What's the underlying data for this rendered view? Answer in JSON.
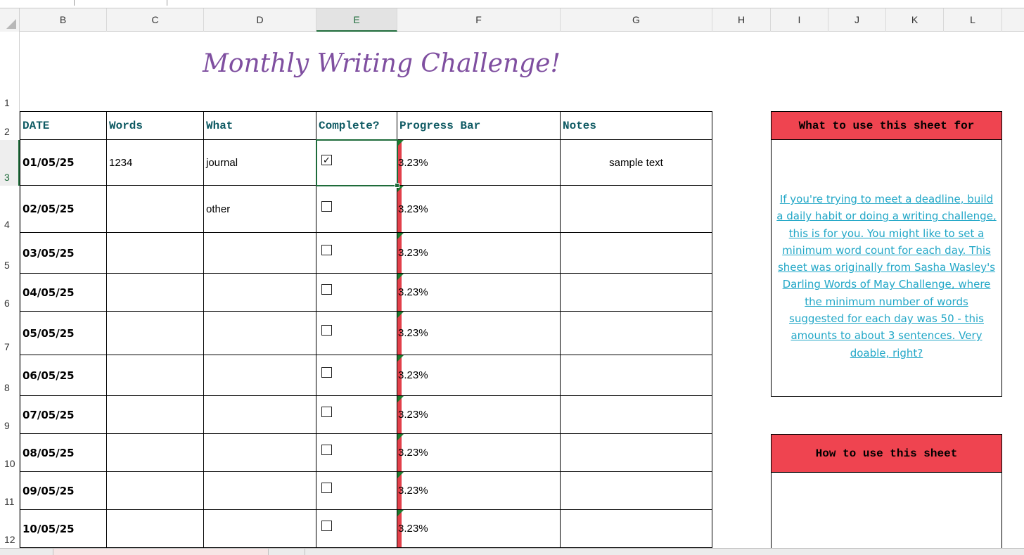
{
  "columns": [
    "B",
    "C",
    "D",
    "E",
    "F",
    "G",
    "H",
    "I",
    "J",
    "K",
    "L"
  ],
  "selected_column": "E",
  "rows": [
    "1",
    "2",
    "3",
    "4",
    "5",
    "6",
    "7",
    "8",
    "9",
    "10",
    "11",
    "12"
  ],
  "selected_row": "3",
  "title": "Monthly Writing Challenge!",
  "table": {
    "headers": {
      "date": "DATE",
      "words": "Words",
      "what": "What",
      "complete": "Complete?",
      "progress": "Progress Bar",
      "notes": "Notes"
    },
    "rows": [
      {
        "date": "01/05/25",
        "words": "1234",
        "what": "journal",
        "complete": true,
        "progress_text": "3.23%",
        "progress": 0.0323,
        "notes": "sample text"
      },
      {
        "date": "02/05/25",
        "words": "",
        "what": "other",
        "complete": false,
        "progress_text": "3.23%",
        "progress": 0.0323,
        "notes": ""
      },
      {
        "date": "03/05/25",
        "words": "",
        "what": "",
        "complete": false,
        "progress_text": "3.23%",
        "progress": 0.0323,
        "notes": ""
      },
      {
        "date": "04/05/25",
        "words": "",
        "what": "",
        "complete": false,
        "progress_text": "3.23%",
        "progress": 0.0323,
        "notes": ""
      },
      {
        "date": "05/05/25",
        "words": "",
        "what": "",
        "complete": false,
        "progress_text": "3.23%",
        "progress": 0.0323,
        "notes": ""
      },
      {
        "date": "06/05/25",
        "words": "",
        "what": "",
        "complete": false,
        "progress_text": "3.23%",
        "progress": 0.0323,
        "notes": ""
      },
      {
        "date": "07/05/25",
        "words": "",
        "what": "",
        "complete": false,
        "progress_text": "3.23%",
        "progress": 0.0323,
        "notes": ""
      },
      {
        "date": "08/05/25",
        "words": "",
        "what": "",
        "complete": false,
        "progress_text": "3.23%",
        "progress": 0.0323,
        "notes": ""
      },
      {
        "date": "09/05/25",
        "words": "",
        "what": "",
        "complete": false,
        "progress_text": "3.23%",
        "progress": 0.0323,
        "notes": ""
      },
      {
        "date": "10/05/25",
        "words": "",
        "what": "",
        "complete": false,
        "progress_text": "3.23%",
        "progress": 0.0323,
        "notes": ""
      }
    ]
  },
  "sidebar": {
    "box1_title": "What to use this sheet for",
    "box1_text": "If you're trying to meet a deadline, build a daily habit or doing a writing challenge, this is for you. You might like to set a minimum word count for each day. This sheet was originally from Sasha Wasley's Darling Words of May Challenge, where the minimum number of words suggested for each day was 50 - this amounts to about 3 sentences. Very doable, right?",
    "box2_title": "How to use this sheet"
  },
  "colors": {
    "title": "#7f4fa0",
    "header_text": "#0e5a63",
    "progress_bar": "#e2404a",
    "side_header": "#ef4450",
    "link_text": "#22a7c7",
    "selection": "#1e6b3a"
  }
}
